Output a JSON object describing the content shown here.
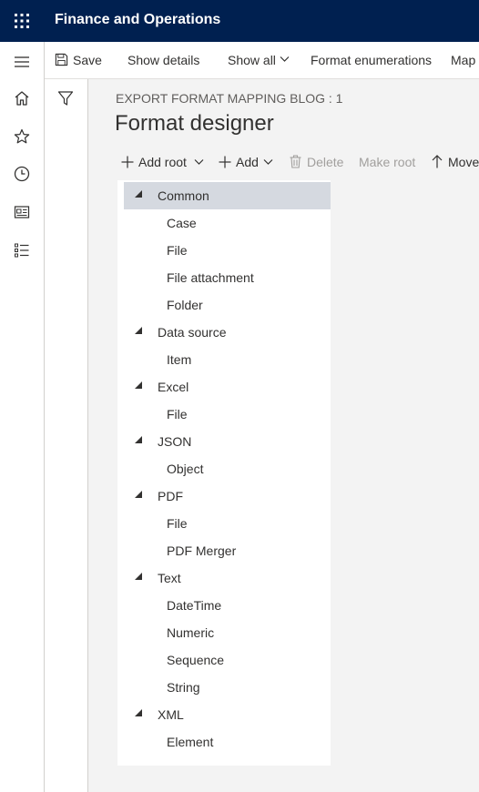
{
  "app": {
    "title": "Finance and Operations"
  },
  "action_pane": {
    "save_label": "Save",
    "show_details_label": "Show details",
    "show_all_label": "Show all",
    "format_enumerations_label": "Format enumerations",
    "map_label": "Map"
  },
  "page": {
    "caption": "EXPORT FORMAT MAPPING BLOG : 1",
    "title": "Format designer"
  },
  "toolbar": {
    "add_root_label": "Add root",
    "add_label": "Add",
    "delete_label": "Delete",
    "make_root_label": "Make root",
    "move_label": "Move"
  },
  "tree": {
    "groups": [
      {
        "label": "Common",
        "children": [
          "Case",
          "File",
          "File attachment",
          "Folder"
        ]
      },
      {
        "label": "Data source",
        "children": [
          "Item"
        ]
      },
      {
        "label": "Excel",
        "children": [
          "File"
        ]
      },
      {
        "label": "JSON",
        "children": [
          "Object"
        ]
      },
      {
        "label": "PDF",
        "children": [
          "File",
          "PDF Merger"
        ]
      },
      {
        "label": "Text",
        "children": [
          "DateTime",
          "Numeric",
          "Sequence",
          "String"
        ]
      },
      {
        "label": "XML",
        "children": [
          "Element"
        ]
      }
    ]
  },
  "icons": {
    "waffle": "waffle-icon",
    "hamburger": "hamburger-icon",
    "home": "home-icon",
    "favorites": "star-icon",
    "recent": "clock-icon",
    "workspaces": "workspace-icon",
    "modules": "modules-list-icon",
    "save": "floppy-icon",
    "filter": "filter-icon",
    "add": "plus-icon",
    "delete": "trash-icon",
    "move_up": "arrow-up-icon"
  },
  "colors": {
    "topbar": "#002050",
    "selected_row": "#d5d9e0",
    "disabled_text": "#a19f9d"
  }
}
